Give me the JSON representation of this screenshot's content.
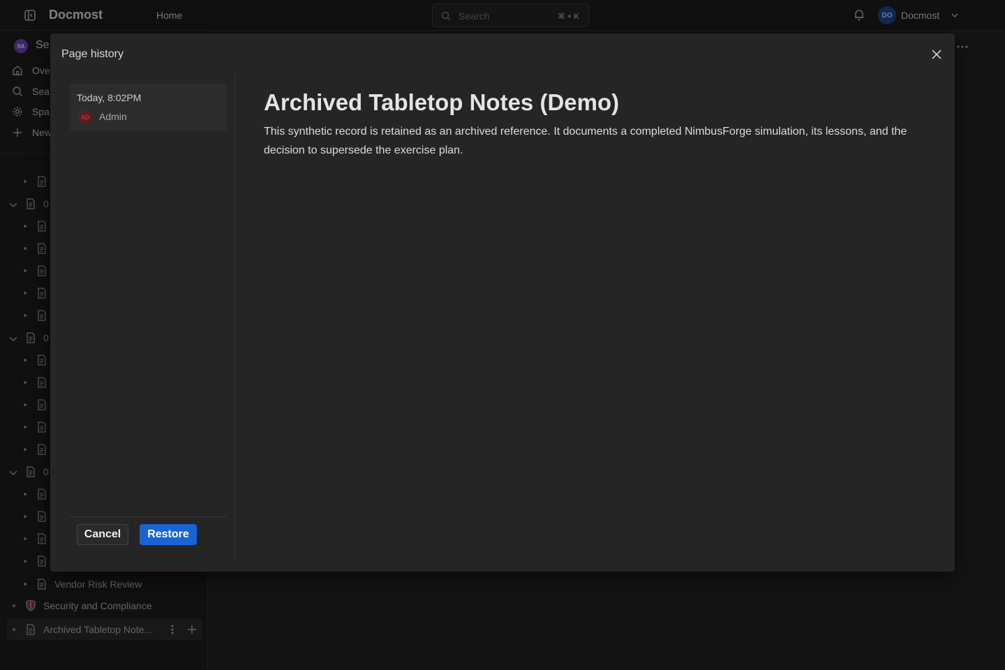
{
  "app": {
    "logo": "Docmost",
    "nav_home": "Home",
    "search_placeholder": "Search",
    "search_shortcut": "⌘ + K",
    "user_initials": "DO",
    "user_name": "Docmost"
  },
  "sidebar": {
    "space_initials": "SA",
    "space_name": "Se",
    "nav": [
      {
        "label": "Ove",
        "icon": "home-icon"
      },
      {
        "label": "Sea",
        "icon": "search-icon"
      },
      {
        "label": "Spa",
        "icon": "gear-icon"
      },
      {
        "label": "New",
        "icon": "plus-icon"
      }
    ],
    "tree_labels": {
      "group1": "0",
      "group2": "0",
      "group3": "0",
      "vendor": "Vendor Risk Review",
      "security": "Security and Compliance",
      "archived": "Archived Tabletop Note..."
    }
  },
  "modal": {
    "title": "Page history",
    "history": [
      {
        "time": "Today, 8:02PM",
        "user_initials": "AD",
        "user": "Admin"
      }
    ],
    "cancel_label": "Cancel",
    "restore_label": "Restore",
    "doc_title": "Archived Tabletop Notes (Demo)",
    "doc_body": "This synthetic record is retained as an archived reference. It documents a completed NimbusForge simulation, its lessons, and the decision to supersede the exercise plan."
  },
  "colors": {
    "accent": "#1864d6",
    "background": "#1f1f1f",
    "modal": "#252525"
  }
}
